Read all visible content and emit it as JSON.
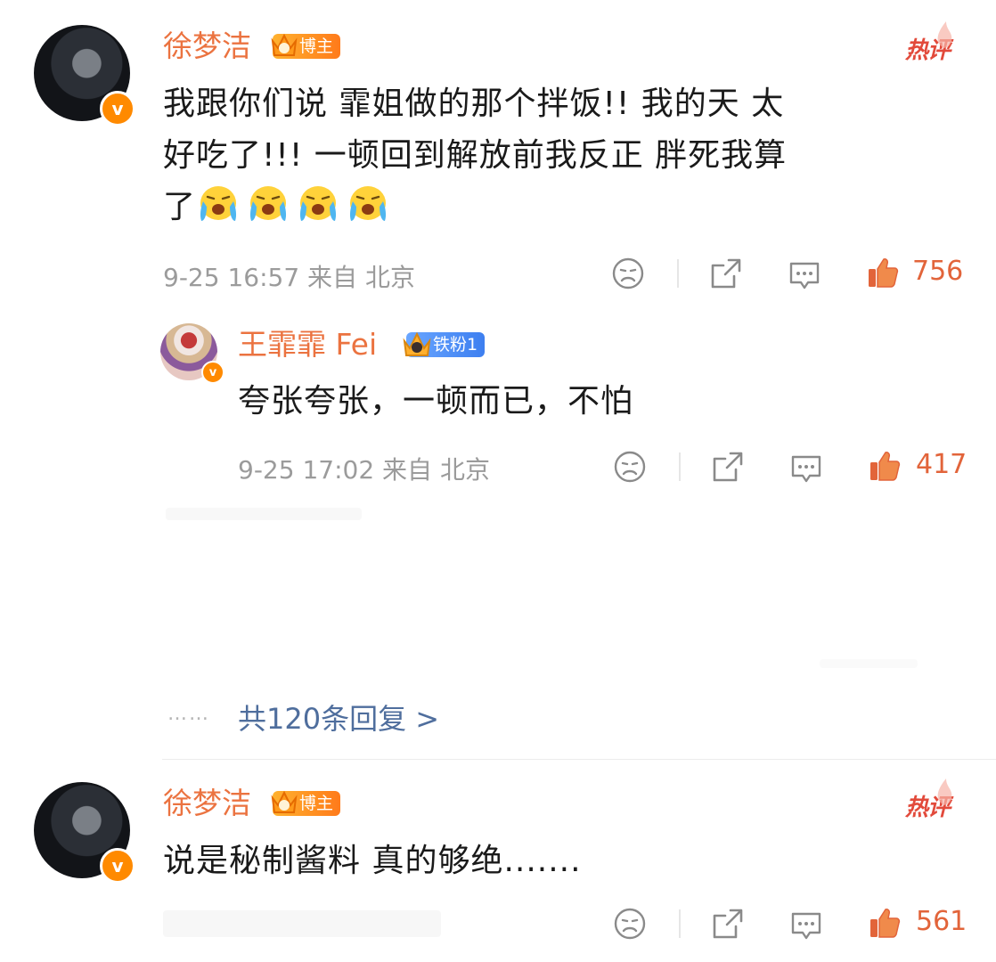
{
  "comments": [
    {
      "author": "徐梦洁",
      "badge": "博主",
      "hot_label": "热评",
      "text_line1": "我跟你们说 霏姐做的那个拌饭!! 我的天 太",
      "text_line2": "好吃了!!!  一顿回到解放前我反正 胖死我算",
      "text_line3": "了",
      "emoji_count": 4,
      "meta": "9-25 16:57 来自 北京",
      "likes": "756"
    },
    {
      "author": "徐梦洁",
      "badge": "博主",
      "hot_label": "热评",
      "text": "说是秘制酱料 真的够绝.......",
      "likes": "561"
    }
  ],
  "reply": {
    "author": "王霏霏 Fei",
    "badge": "铁粉1",
    "text": "夸张夸张，一顿而已，不怕",
    "meta": "9-25 17:02 来自 北京",
    "likes": "417"
  },
  "more_replies": {
    "dots": "……",
    "label": "共120条回复 >"
  },
  "colors": {
    "name": "#eb7340",
    "link": "#4f6e9d",
    "like": "#e2643a",
    "meta": "#9b9b9b"
  },
  "icons": [
    "sad-face-icon",
    "share-icon",
    "comment-icon",
    "like-icon",
    "verified-icon",
    "crown-icon",
    "crying-emoji-icon"
  ]
}
